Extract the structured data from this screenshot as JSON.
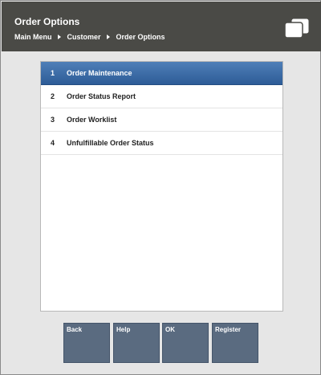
{
  "header": {
    "title": "Order Options",
    "breadcrumb": [
      "Main Menu",
      "Customer",
      "Order Options"
    ]
  },
  "icons": {
    "windows": "windows-icon",
    "breadcrumb_separator": "caret-right-icon"
  },
  "menu": {
    "selected_index": 0,
    "items": [
      {
        "number": "1",
        "label": "Order Maintenance"
      },
      {
        "number": "2",
        "label": "Order Status Report"
      },
      {
        "number": "3",
        "label": "Order Worklist"
      },
      {
        "number": "4",
        "label": "Unfulfillable Order Status"
      }
    ]
  },
  "buttons": {
    "back": "Back",
    "help": "Help",
    "ok": "OK",
    "register": "Register"
  },
  "colors": {
    "header_bg": "#4a4a46",
    "selected_row": "#3a6aa5",
    "button_bg": "#5a6b80",
    "page_bg": "#e6e6e6"
  }
}
